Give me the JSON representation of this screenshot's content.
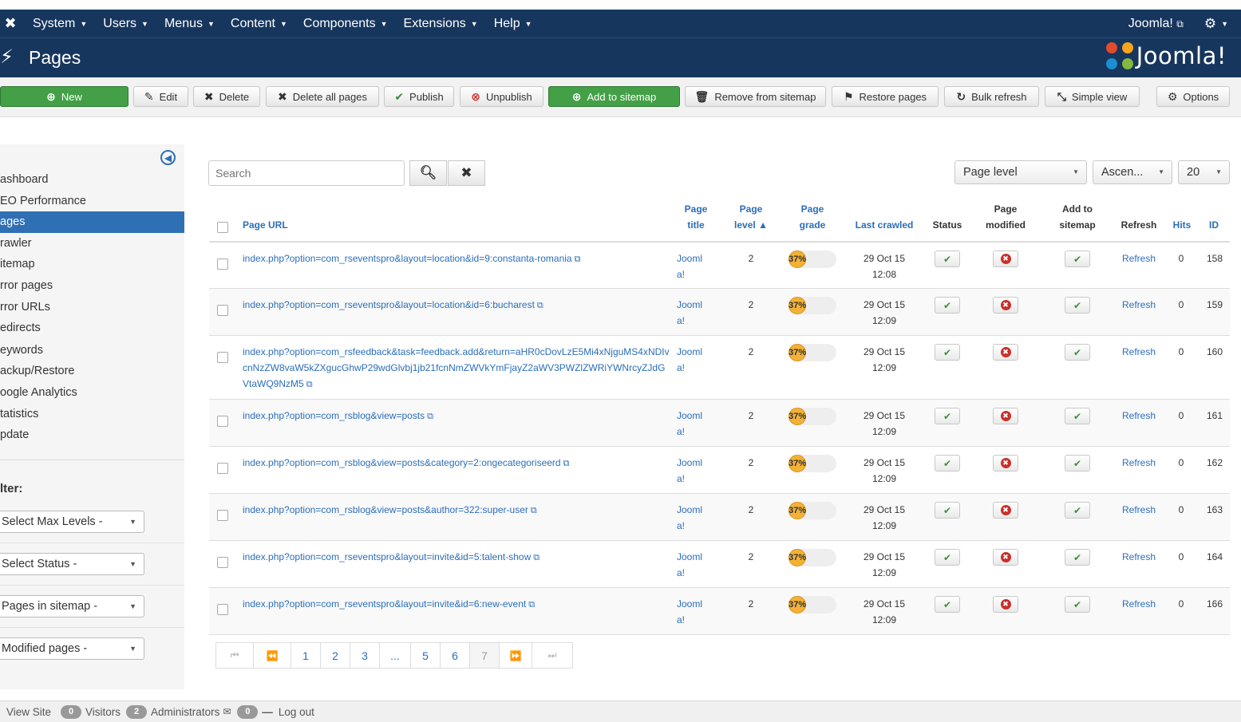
{
  "topnav": {
    "menu": [
      "System",
      "Users",
      "Menus",
      "Content",
      "Components",
      "Extensions",
      "Help"
    ],
    "site_link": "Joomla!",
    "site_link_icon": "external-link-icon",
    "settings_icon": "gear-icon"
  },
  "header": {
    "title": "Pages",
    "title_icon": "lightning-bolt-icon",
    "brand": "Joomla!"
  },
  "toolbar": {
    "new": "New",
    "edit": "Edit",
    "delete": "Delete",
    "delete_all": "Delete all pages",
    "publish": "Publish",
    "unpublish": "Unpublish",
    "add_to_sitemap": "Add to sitemap",
    "remove_from_sitemap": "Remove from sitemap",
    "restore_pages": "Restore pages",
    "bulk_refresh": "Bulk refresh",
    "simple_view": "Simple view",
    "options": "Options"
  },
  "sidebar": {
    "items": [
      {
        "label": "ashboard"
      },
      {
        "label": "EO Performance"
      },
      {
        "label": "ages"
      },
      {
        "label": "rawler"
      },
      {
        "label": "itemap"
      },
      {
        "label": "rror pages"
      },
      {
        "label": "rror URLs"
      },
      {
        "label": "edirects"
      },
      {
        "label": "eywords"
      },
      {
        "label": "ackup/Restore"
      },
      {
        "label": "oogle Analytics"
      },
      {
        "label": "tatistics"
      },
      {
        "label": "pdate"
      }
    ],
    "active_item": "ages",
    "filter_label": "lter:",
    "filters": [
      {
        "label": "Select Max Levels -"
      },
      {
        "label": "Select Status -"
      },
      {
        "label": "Pages in sitemap -"
      },
      {
        "label": "Modified pages -"
      }
    ]
  },
  "search": {
    "placeholder": "Search"
  },
  "list_controls": {
    "order_by": "Page level",
    "direction": "Ascen...",
    "limit": "20"
  },
  "table": {
    "headers": {
      "page_url": "Page URL",
      "page_title_1": "Page",
      "page_title_2": "title",
      "page_level_1": "Page",
      "page_level_2": "level ▲",
      "page_grade_1": "Page",
      "page_grade_2": "grade",
      "last_crawled": "Last crawled",
      "status": "Status",
      "page_modified_1": "Page",
      "page_modified_2": "modified",
      "add_to_sitemap_1": "Add to",
      "add_to_sitemap_2": "sitemap",
      "refresh": "Refresh",
      "hits": "Hits",
      "id": "ID"
    },
    "rows": [
      {
        "url": "index.php?option=com_rseventspro&layout=location&id=9:constanta-romania",
        "title_1": "Jooml",
        "title_2": "a!",
        "level": "2",
        "grade": "37%",
        "grade_value": 0.37,
        "date": "29 Oct 15",
        "time": "12:08",
        "status": "published",
        "modified": "no",
        "in_sitemap": "yes",
        "refresh": "Refresh",
        "hits": "0",
        "id": "158"
      },
      {
        "url": "index.php?option=com_rseventspro&layout=location&id=6:bucharest",
        "title_1": "Jooml",
        "title_2": "a!",
        "level": "2",
        "grade": "37%",
        "grade_value": 0.37,
        "date": "29 Oct 15",
        "time": "12:09",
        "status": "published",
        "modified": "no",
        "in_sitemap": "yes",
        "refresh": "Refresh",
        "hits": "0",
        "id": "159"
      },
      {
        "url": "index.php?option=com_rsfeedback&task=feedback.add&return=aHR0cDovLzE5Mi4xNjguMS4xNDIvcnNzZW8vaW5kZXgucGhwP29wdGlvbj1jb21fcnNmZWVkYmFjayZ2aWV3PWZlZWRiYWNrcyZJdGVtaWQ9NzM5",
        "title_1": "Jooml",
        "title_2": "a!",
        "level": "2",
        "grade": "37%",
        "grade_value": 0.37,
        "date": "29 Oct 15",
        "time": "12:09",
        "status": "published",
        "modified": "no",
        "in_sitemap": "yes",
        "refresh": "Refresh",
        "hits": "0",
        "id": "160"
      },
      {
        "url": "index.php?option=com_rsblog&view=posts",
        "title_1": "Jooml",
        "title_2": "a!",
        "level": "2",
        "grade": "37%",
        "grade_value": 0.37,
        "date": "29 Oct 15",
        "time": "12:09",
        "status": "published",
        "modified": "no",
        "in_sitemap": "yes",
        "refresh": "Refresh",
        "hits": "0",
        "id": "161"
      },
      {
        "url": "index.php?option=com_rsblog&view=posts&category=2:ongecategoriseerd",
        "title_1": "Jooml",
        "title_2": "a!",
        "level": "2",
        "grade": "37%",
        "grade_value": 0.37,
        "date": "29 Oct 15",
        "time": "12:09",
        "status": "published",
        "modified": "no",
        "in_sitemap": "yes",
        "refresh": "Refresh",
        "hits": "0",
        "id": "162"
      },
      {
        "url": "index.php?option=com_rsblog&view=posts&author=322:super-user",
        "title_1": "Jooml",
        "title_2": "a!",
        "level": "2",
        "grade": "37%",
        "grade_value": 0.37,
        "date": "29 Oct 15",
        "time": "12:09",
        "status": "published",
        "modified": "no",
        "in_sitemap": "yes",
        "refresh": "Refresh",
        "hits": "0",
        "id": "163"
      },
      {
        "url": "index.php?option=com_rseventspro&layout=invite&id=5:talent-show",
        "title_1": "Jooml",
        "title_2": "a!",
        "level": "2",
        "grade": "37%",
        "grade_value": 0.37,
        "date": "29 Oct 15",
        "time": "12:09",
        "status": "published",
        "modified": "no",
        "in_sitemap": "yes",
        "refresh": "Refresh",
        "hits": "0",
        "id": "164"
      },
      {
        "url": "index.php?option=com_rseventspro&layout=invite&id=6:new-event",
        "title_1": "Jooml",
        "title_2": "a!",
        "level": "2",
        "grade": "37%",
        "grade_value": 0.37,
        "date": "29 Oct 15",
        "time": "12:09",
        "status": "published",
        "modified": "no",
        "in_sitemap": "yes",
        "refresh": "Refresh",
        "hits": "0",
        "id": "166"
      }
    ]
  },
  "pagination": {
    "first_icon": "first-page-icon",
    "prev_icon": "prev-page-icon",
    "pages": [
      "1",
      "2",
      "3",
      "...",
      "5",
      "6",
      "7"
    ],
    "current": "7",
    "next_icon": "next-page-icon",
    "last_icon": "last-page-icon"
  },
  "statusbar": {
    "view_site": "View Site",
    "visitors_count": "0",
    "visitors": "Visitors",
    "admins_count": "2",
    "admins": "Administrators",
    "messages_count": "0",
    "logout": "Log out"
  },
  "colors": {
    "nav_bg": "#17365d",
    "accent": "#2f6fb4",
    "link": "#2a6ebb",
    "green_button": "#43a047",
    "grade": "#f3b236",
    "danger": "#c9302c"
  }
}
